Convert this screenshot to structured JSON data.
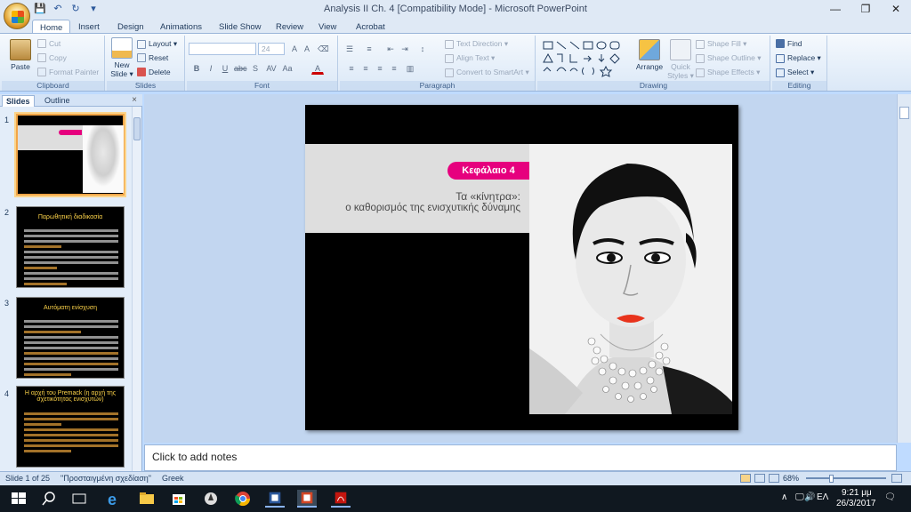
{
  "window": {
    "title": "Analysis II Ch. 4 [Compatibility Mode] - Microsoft PowerPoint",
    "minimize": "—",
    "restore": "❐",
    "close": "✕"
  },
  "tabs": [
    "Home",
    "Insert",
    "Design",
    "Animations",
    "Slide Show",
    "Review",
    "View",
    "Acrobat"
  ],
  "ribbon": {
    "clipboard": {
      "label": "Clipboard",
      "paste": "Paste",
      "cut": "Cut",
      "copy": "Copy",
      "format_painter": "Format Painter"
    },
    "slides": {
      "label": "Slides",
      "new_slide": "New",
      "new_slide2": "Slide ▾",
      "layout": "Layout ▾",
      "reset": "Reset",
      "delete": "Delete"
    },
    "font": {
      "label": "Font",
      "font_size": "24"
    },
    "paragraph": {
      "label": "Paragraph",
      "text_direction": "Text Direction ▾",
      "align_text": "Align Text ▾",
      "convert": "Convert to SmartArt ▾"
    },
    "drawing": {
      "label": "Drawing",
      "arrange": "Arrange",
      "quick_styles": "Quick",
      "quick_styles2": "Styles ▾",
      "shape_fill": "Shape Fill ▾",
      "shape_outline": "Shape Outline ▾",
      "shape_effects": "Shape Effects ▾"
    },
    "editing": {
      "label": "Editing",
      "find": "Find",
      "replace": "Replace ▾",
      "select": "Select ▾"
    }
  },
  "panel": {
    "slides_tab": "Slides",
    "outline_tab": "Outline",
    "close": "×",
    "thumbs": [
      {
        "num": "1",
        "title": ""
      },
      {
        "num": "2",
        "title": "Παρωθητική διαδικασία"
      },
      {
        "num": "3",
        "title": "Αυτόματη ενίσχυση"
      },
      {
        "num": "4",
        "title": "Η αρχή του Premack (η αρχή της σχετικότητας ενισχυτών)"
      }
    ]
  },
  "slide": {
    "chapter": "Κεφάλαιο 4",
    "subtitle1": "Τα «κίνητρα»:",
    "subtitle2": "ο καθορισμός της ενισχυτικής δύναμης"
  },
  "notes": {
    "placeholder": "Click to add notes"
  },
  "status": {
    "slide": "Slide 1 of 25",
    "theme": "\"Προσταιγμένη σχεδίαση\"",
    "language": "Greek",
    "zoom": "68%"
  },
  "tray": {
    "lang": "ΕΛ",
    "time": "9:21 μμ",
    "date": "26/3/2017"
  }
}
